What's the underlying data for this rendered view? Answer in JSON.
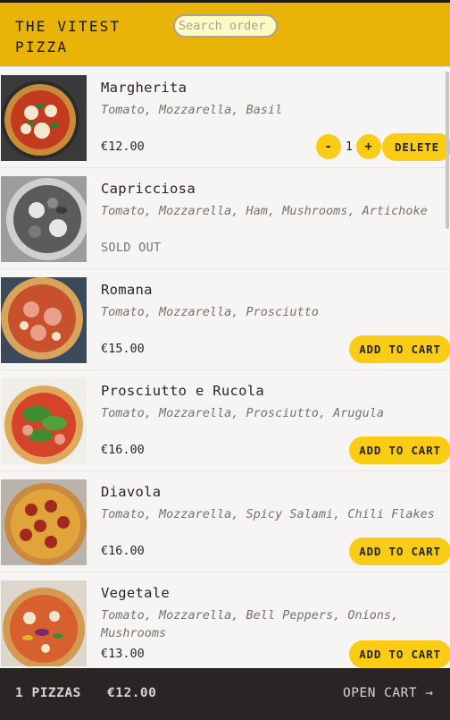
{
  "header": {
    "brand": "THE VITEST PIZZA",
    "search_placeholder": "Search order"
  },
  "menu": [
    {
      "name": "Margherita",
      "ingredients": "Tomato, Mozzarella, Basil",
      "price": "€12.00",
      "sold_out": false,
      "in_cart": true,
      "quantity": "1"
    },
    {
      "name": "Capricciosa",
      "ingredients": "Tomato, Mozzarella, Ham, Mushrooms, Artichoke",
      "price": "",
      "sold_out": true,
      "status": "SOLD OUT"
    },
    {
      "name": "Romana",
      "ingredients": "Tomato, Mozzarella, Prosciutto",
      "price": "€15.00",
      "sold_out": false
    },
    {
      "name": "Prosciutto e Rucola",
      "ingredients": "Tomato, Mozzarella, Prosciutto, Arugula",
      "price": "€16.00",
      "sold_out": false
    },
    {
      "name": "Diavola",
      "ingredients": "Tomato, Mozzarella, Spicy Salami, Chili Flakes",
      "price": "€16.00",
      "sold_out": false
    },
    {
      "name": "Vegetale",
      "ingredients": "Tomato, Mozzarella, Bell Peppers, Onions, Mushrooms",
      "price": "€13.00",
      "sold_out": false
    }
  ],
  "buttons": {
    "add_to_cart": "ADD TO CART",
    "delete": "DELETE",
    "decrease": "-",
    "increase": "+"
  },
  "cart": {
    "count": "1 PIZZAS",
    "total": "€12.00",
    "open_label": "OPEN CART →"
  },
  "colors": {
    "header": "#eab308",
    "button": "#facc15",
    "footer": "#292524"
  }
}
